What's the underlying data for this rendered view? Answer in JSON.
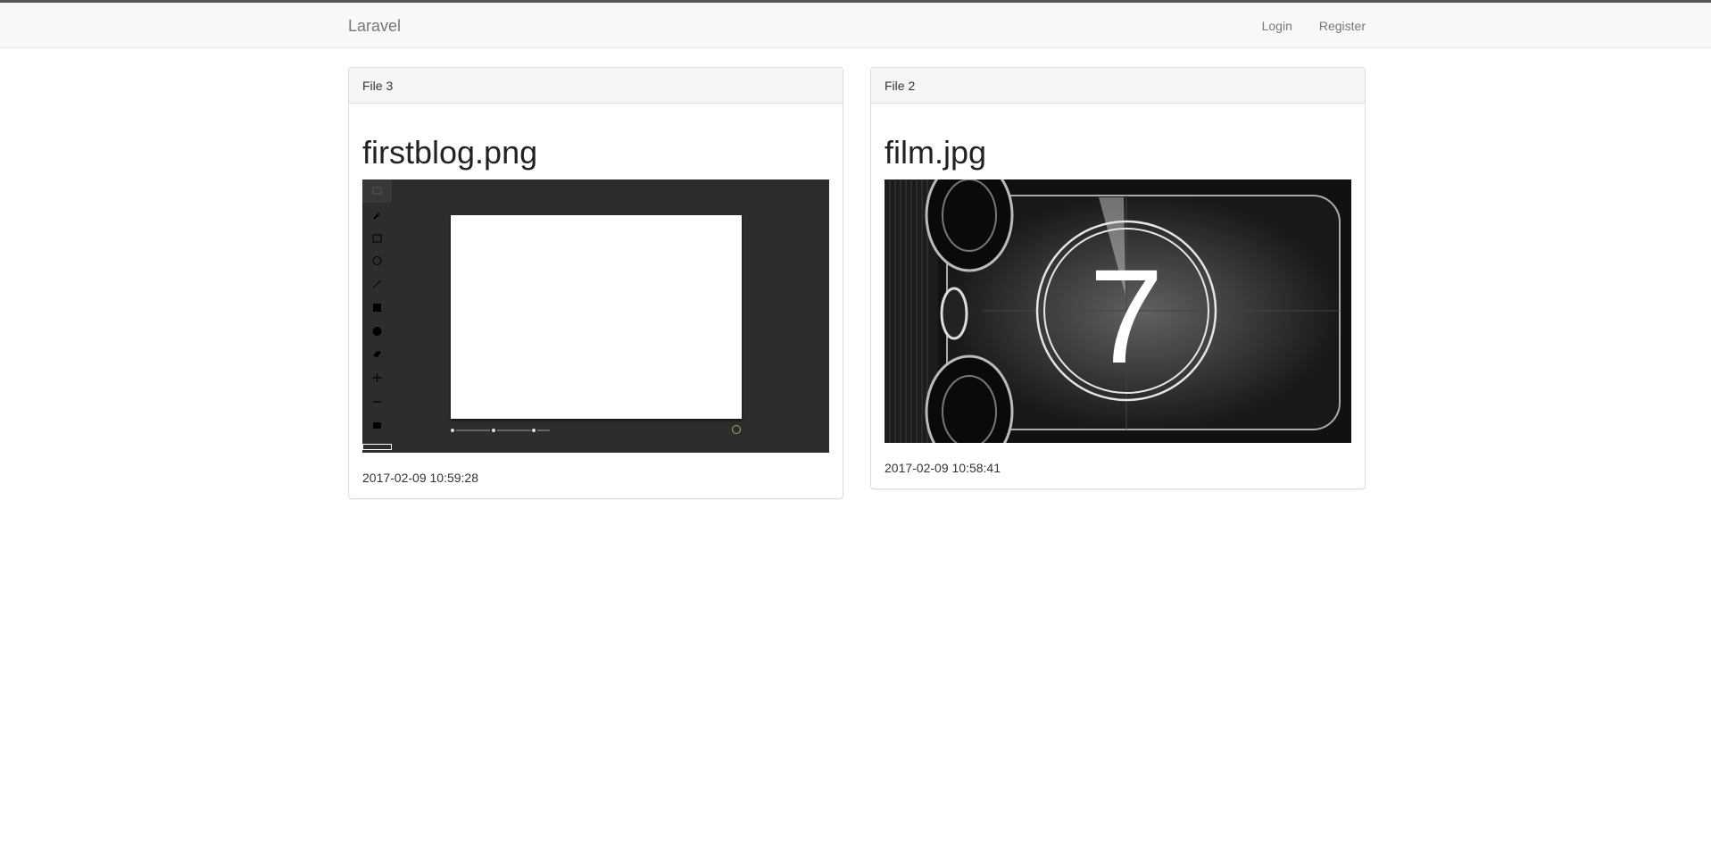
{
  "navbar": {
    "brand": "Laravel",
    "links": [
      "Login",
      "Register"
    ]
  },
  "files": [
    {
      "heading": "File 3",
      "filename": "firstblog.png",
      "date": "2017-02-09 10:59:28",
      "image_kind": "paint-app-screenshot"
    },
    {
      "heading": "File 2",
      "filename": "film.jpg",
      "date": "2017-02-09 10:58:41",
      "image_kind": "film-countdown",
      "countdown_number": "7"
    }
  ],
  "colors": {
    "navbar_bg": "#f8f8f8",
    "panel_heading_bg": "#f5f5f5",
    "border": "#dddddd"
  }
}
